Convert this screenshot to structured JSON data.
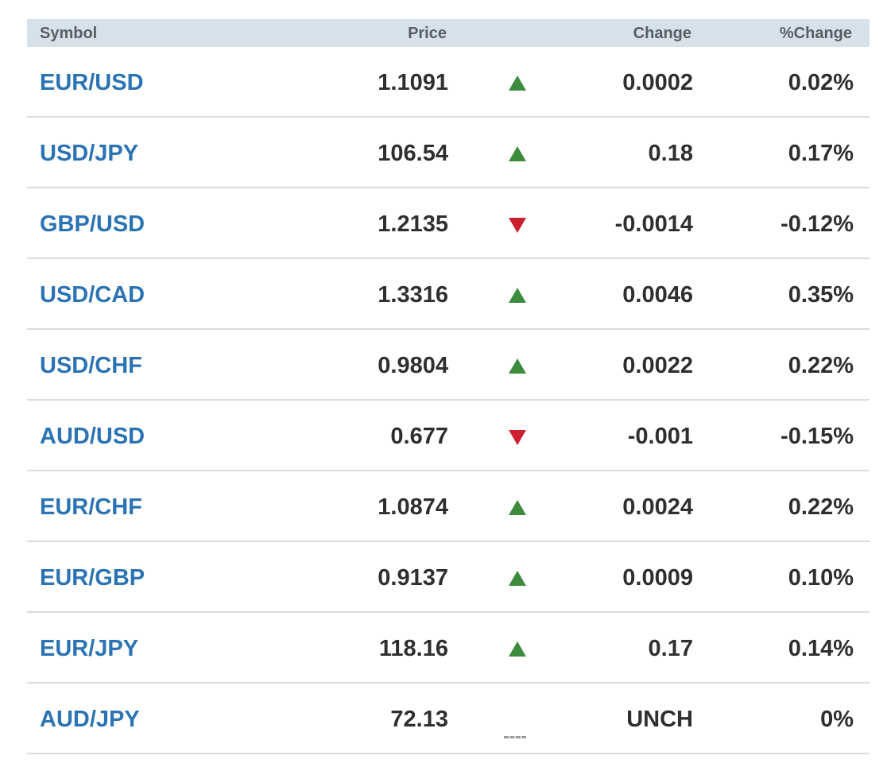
{
  "header": {
    "symbol": "Symbol",
    "price": "Price",
    "change": "Change",
    "pct_change": "%Change"
  },
  "colors": {
    "header_bg": "#d6e1ea",
    "symbol_link": "#2b73b3",
    "up": "#3d8b3d",
    "down": "#cc1f2f",
    "unchanged": "#9a9a9a"
  },
  "rows": [
    {
      "symbol": "EUR/USD",
      "price": "1.1091",
      "direction": "up",
      "change": "0.0002",
      "pct_change": "0.02%"
    },
    {
      "symbol": "USD/JPY",
      "price": "106.54",
      "direction": "up",
      "change": "0.18",
      "pct_change": "0.17%"
    },
    {
      "symbol": "GBP/USD",
      "price": "1.2135",
      "direction": "down",
      "change": "-0.0014",
      "pct_change": "-0.12%"
    },
    {
      "symbol": "USD/CAD",
      "price": "1.3316",
      "direction": "up",
      "change": "0.0046",
      "pct_change": "0.35%"
    },
    {
      "symbol": "USD/CHF",
      "price": "0.9804",
      "direction": "up",
      "change": "0.0022",
      "pct_change": "0.22%"
    },
    {
      "symbol": "AUD/USD",
      "price": "0.677",
      "direction": "down",
      "change": "-0.001",
      "pct_change": "-0.15%"
    },
    {
      "symbol": "EUR/CHF",
      "price": "1.0874",
      "direction": "up",
      "change": "0.0024",
      "pct_change": "0.22%"
    },
    {
      "symbol": "EUR/GBP",
      "price": "0.9137",
      "direction": "up",
      "change": "0.0009",
      "pct_change": "0.10%"
    },
    {
      "symbol": "EUR/JPY",
      "price": "118.16",
      "direction": "up",
      "change": "0.17",
      "pct_change": "0.14%"
    },
    {
      "symbol": "AUD/JPY",
      "price": "72.13",
      "direction": "unchanged",
      "change": "UNCH",
      "pct_change": "0%"
    }
  ]
}
